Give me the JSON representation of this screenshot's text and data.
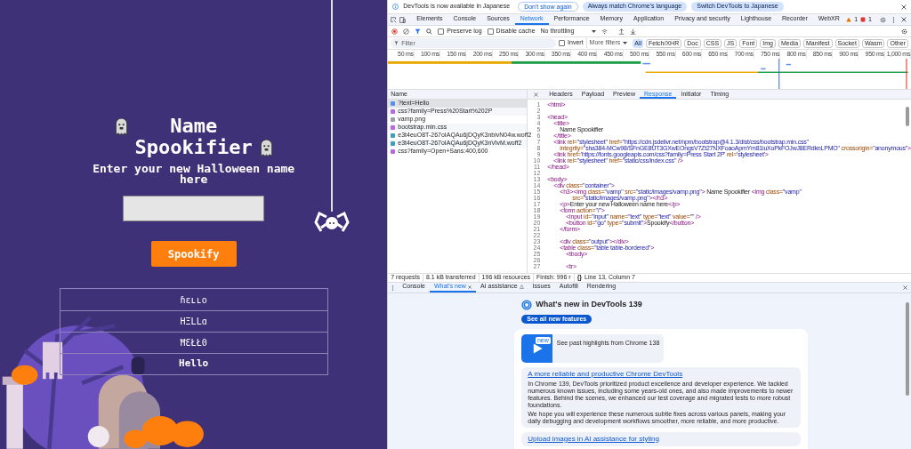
{
  "page": {
    "heading": "Name Spookifier",
    "prompt": "Enter your new Halloween name here",
    "button": "Spookify",
    "results": [
      "ɦɛʟʟօ",
      "HΞLLɑ",
      "ĦƐŁŁ0",
      "Hello"
    ]
  },
  "devtools": {
    "banner": {
      "message": "DevTools is now available in Japanese",
      "buttons": [
        {
          "label": "Don't show again",
          "kind": "outline"
        },
        {
          "label": "Always match Chrome's language",
          "kind": "filled"
        },
        {
          "label": "Switch DevTools to Japanese",
          "kind": "filled"
        }
      ]
    },
    "tabs": [
      {
        "label": "Elements",
        "selected": false
      },
      {
        "label": "Console",
        "selected": false
      },
      {
        "label": "Sources",
        "selected": false
      },
      {
        "label": "Network",
        "selected": true
      },
      {
        "label": "Performance",
        "selected": false
      },
      {
        "label": "Memory",
        "selected": false
      },
      {
        "label": "Application",
        "selected": false
      },
      {
        "label": "Privacy and security",
        "selected": false
      },
      {
        "label": "Lighthouse",
        "selected": false
      },
      {
        "label": "Recorder",
        "selected": false
      },
      {
        "label": "WebXR",
        "selected": false
      }
    ],
    "warnings": "1",
    "errors": "1",
    "toolbar": {
      "preserve_log": {
        "label": "Preserve log",
        "checked": false
      },
      "disable_cache": {
        "label": "Disable cache",
        "checked": false
      },
      "throttling": "No throttling"
    },
    "filter": {
      "placeholder": "Filter",
      "invert": {
        "label": "Invert",
        "checked": false
      },
      "more_filters": "More filters",
      "types": [
        {
          "label": "All",
          "selected": true
        },
        {
          "label": "Fetch/XHR",
          "selected": false
        },
        {
          "label": "Doc",
          "selected": false
        },
        {
          "label": "CSS",
          "selected": false
        },
        {
          "label": "JS",
          "selected": false
        },
        {
          "label": "Font",
          "selected": false
        },
        {
          "label": "Img",
          "selected": false
        },
        {
          "label": "Media",
          "selected": false
        },
        {
          "label": "Manifest",
          "selected": false
        },
        {
          "label": "Socket",
          "selected": false
        },
        {
          "label": "Wasm",
          "selected": false
        },
        {
          "label": "Other",
          "selected": false
        }
      ]
    },
    "timeline": {
      "ticks": [
        "50 ms",
        "100 ms",
        "150 ms",
        "200 ms",
        "250 ms",
        "300 ms",
        "350 ms",
        "400 ms",
        "450 ms",
        "500 ms",
        "550 ms",
        "600 ms",
        "650 ms",
        "700 ms",
        "750 ms",
        "800 ms",
        "850 ms",
        "900 ms",
        "950 ms",
        "1,000 ms"
      ]
    },
    "requests": {
      "column": "Name",
      "items": [
        {
          "name": "?text=Hello",
          "kind": "doc",
          "selected": true
        },
        {
          "name": "css?family=Press%20Start%202P",
          "kind": "css",
          "selected": false
        },
        {
          "name": "vamp.png",
          "kind": "img",
          "selected": false
        },
        {
          "name": "bootstrap.min.css",
          "kind": "css",
          "selected": false
        },
        {
          "name": "e3t4euO8T-267oIAQAu6jDQyK3nbivN04w.woff2",
          "kind": "font",
          "selected": false
        },
        {
          "name": "e3t4euO8T-267oIAQAu6jDQyK3nVivM.woff2",
          "kind": "font",
          "selected": false
        },
        {
          "name": "css?family=Open+Sans:400,600",
          "kind": "css",
          "selected": false
        }
      ]
    },
    "detail_tabs": [
      {
        "label": "Headers",
        "selected": false
      },
      {
        "label": "Payload",
        "selected": false
      },
      {
        "label": "Preview",
        "selected": false
      },
      {
        "label": "Response",
        "selected": true
      },
      {
        "label": "Initiator",
        "selected": false
      },
      {
        "label": "Timing",
        "selected": false
      }
    ],
    "response_lines": [
      {
        "number": "1",
        "parts": [
          {
            "kind": "tag",
            "text": "<html>"
          }
        ]
      },
      {
        "number": "2"
      },
      {
        "number": "3",
        "parts": [
          {
            "kind": "tag",
            "text": "<head>"
          }
        ]
      },
      {
        "number": "4",
        "parts": [
          {
            "kind": "tag",
            "text": "    <title>"
          }
        ]
      },
      {
        "number": "5",
        "parts": [
          {
            "kind": "text",
            "text": "        Name Spookifier"
          }
        ]
      },
      {
        "number": "6",
        "parts": [
          {
            "kind": "tag",
            "text": "    </title>"
          }
        ]
      },
      {
        "number": "7",
        "parts": [
          {
            "kind": "tag",
            "text": "    <link "
          },
          {
            "kind": "attr",
            "text": "rel="
          },
          {
            "kind": "val",
            "text": "\"stylesheet\" "
          },
          {
            "kind": "attr",
            "text": "href="
          },
          {
            "kind": "val",
            "text": "\"https://cdn.jsdelivr.net/npm/bootstrap@4.1.3/dist/css/bootstrap.min.css\""
          }
        ]
      },
      {
        "number": "8",
        "parts": [
          {
            "kind": "attr",
            "text": "        integrity="
          },
          {
            "kind": "val",
            "text": "\"sha384-MCw98/SFnGE8fJT3GXwEOngsV7Zt27NXFoaoApmYm81iuXoPkFOJwJ8ERdknLPMO\" "
          },
          {
            "kind": "attr",
            "text": "crossorigin="
          },
          {
            "kind": "val",
            "text": "\"anonymous\""
          },
          {
            "kind": "tag",
            "text": ">"
          }
        ]
      },
      {
        "number": "9",
        "parts": [
          {
            "kind": "tag",
            "text": "    <link "
          },
          {
            "kind": "attr",
            "text": "href="
          },
          {
            "kind": "val",
            "text": "'https://fonts.googleapis.com/css?family=Press Start 2P' "
          },
          {
            "kind": "attr",
            "text": "rel="
          },
          {
            "kind": "val",
            "text": "'stylesheet'"
          },
          {
            "kind": "tag",
            "text": ">"
          }
        ]
      },
      {
        "number": "10",
        "parts": [
          {
            "kind": "tag",
            "text": "    <link "
          },
          {
            "kind": "attr",
            "text": "rel="
          },
          {
            "kind": "val",
            "text": "\"stylesheet\" "
          },
          {
            "kind": "attr",
            "text": "href="
          },
          {
            "kind": "val",
            "text": "\"static/css/index.css\" "
          },
          {
            "kind": "tag",
            "text": "/>"
          }
        ]
      },
      {
        "number": "11",
        "parts": [
          {
            "kind": "tag",
            "text": "</head>"
          }
        ]
      },
      {
        "number": "12"
      },
      {
        "number": "13",
        "parts": [
          {
            "kind": "tag",
            "text": "<body>"
          }
        ]
      },
      {
        "number": "14",
        "parts": [
          {
            "kind": "tag",
            "text": "    <div "
          },
          {
            "kind": "attr",
            "text": "class="
          },
          {
            "kind": "val",
            "text": "\"container\""
          },
          {
            "kind": "tag",
            "text": ">"
          }
        ]
      },
      {
        "number": "15",
        "parts": [
          {
            "kind": "tag",
            "text": "        <h3><img "
          },
          {
            "kind": "attr",
            "text": "class="
          },
          {
            "kind": "val",
            "text": "\"vamp\" "
          },
          {
            "kind": "attr",
            "text": "src="
          },
          {
            "kind": "val",
            "text": "\"static/images/vamp.png\""
          },
          {
            "kind": "tag",
            "text": ">"
          },
          {
            "kind": "text",
            "text": " Name Spookifier "
          },
          {
            "kind": "tag",
            "text": "<img "
          },
          {
            "kind": "attr",
            "text": "class="
          },
          {
            "kind": "val",
            "text": "\"vamp\""
          }
        ]
      },
      {
        "number": "16",
        "parts": [
          {
            "kind": "attr",
            "text": "                src="
          },
          {
            "kind": "val",
            "text": "\"static/images/vamp.png\""
          },
          {
            "kind": "tag",
            "text": "></h3>"
          }
        ]
      },
      {
        "number": "17",
        "parts": [
          {
            "kind": "tag",
            "text": "        <p>"
          },
          {
            "kind": "text",
            "text": "Enter your new Halloween name here"
          },
          {
            "kind": "tag",
            "text": "</p>"
          }
        ]
      },
      {
        "number": "18",
        "parts": [
          {
            "kind": "tag",
            "text": "        <form "
          },
          {
            "kind": "attr",
            "text": "action="
          },
          {
            "kind": "val",
            "text": "\"/\""
          },
          {
            "kind": "tag",
            "text": ">"
          }
        ]
      },
      {
        "number": "19",
        "parts": [
          {
            "kind": "tag",
            "text": "            <input "
          },
          {
            "kind": "attr",
            "text": "id="
          },
          {
            "kind": "val",
            "text": "\"input\" "
          },
          {
            "kind": "attr",
            "text": "name="
          },
          {
            "kind": "val",
            "text": "\"text\" "
          },
          {
            "kind": "attr",
            "text": "type="
          },
          {
            "kind": "val",
            "text": "\"text\" "
          },
          {
            "kind": "attr",
            "text": "value="
          },
          {
            "kind": "val",
            "text": "\"\" "
          },
          {
            "kind": "tag",
            "text": "/>"
          }
        ]
      },
      {
        "number": "20",
        "parts": [
          {
            "kind": "tag",
            "text": "            <button "
          },
          {
            "kind": "attr",
            "text": "id="
          },
          {
            "kind": "val",
            "text": "\"go\" "
          },
          {
            "kind": "attr",
            "text": "type="
          },
          {
            "kind": "val",
            "text": "\"submit\""
          },
          {
            "kind": "tag",
            "text": ">"
          },
          {
            "kind": "text",
            "text": "Spookify"
          },
          {
            "kind": "tag",
            "text": "</button>"
          }
        ]
      },
      {
        "number": "21",
        "parts": [
          {
            "kind": "tag",
            "text": "        </form>"
          }
        ]
      },
      {
        "number": "22"
      },
      {
        "number": "23",
        "parts": [
          {
            "kind": "tag",
            "text": "        <div "
          },
          {
            "kind": "attr",
            "text": "class="
          },
          {
            "kind": "val",
            "text": "\"output\""
          },
          {
            "kind": "tag",
            "text": "></div>"
          }
        ]
      },
      {
        "number": "24",
        "parts": [
          {
            "kind": "tag",
            "text": "        <table "
          },
          {
            "kind": "attr",
            "text": "class="
          },
          {
            "kind": "val",
            "text": "\"table table-bordered\""
          },
          {
            "kind": "tag",
            "text": ">"
          }
        ]
      },
      {
        "number": "25",
        "parts": [
          {
            "kind": "tag",
            "text": "            <tbody>"
          }
        ]
      },
      {
        "number": "26"
      },
      {
        "number": "27",
        "parts": [
          {
            "kind": "tag",
            "text": "            <tr>"
          }
        ]
      }
    ],
    "status": {
      "summary": [
        "7 requests",
        "8.1 kB transferred",
        "196 kB resources",
        "Finish: 996 r"
      ],
      "pretty_print": "{}",
      "cursor": "Line 13, Column 7"
    },
    "drawer": {
      "tabs": [
        {
          "label": "Console",
          "selected": false,
          "kind": "plain"
        },
        {
          "label": "What's new",
          "selected": true,
          "kind": "closable"
        },
        {
          "label": "AI assistance",
          "selected": false,
          "kind": "experimental"
        },
        {
          "label": "Issues",
          "selected": false,
          "kind": "plain"
        },
        {
          "label": "Autofill",
          "selected": false,
          "kind": "plain"
        },
        {
          "label": "Rendering",
          "selected": false,
          "kind": "plain"
        }
      ],
      "title": "What's new in DevTools 139",
      "button": "See all new features",
      "video": {
        "badge": "new",
        "caption": "See past highlights from Chrome 138"
      },
      "articles": [
        {
          "title": "A more reliable and productive Chrome DevTools",
          "paragraphs": [
            "In Chrome 139, DevTools prioritized product excellence and developer experience. We tackled numerous known issues, including some years-old ones, and also made improvements to newer features. Behind the scenes, we enhanced our test coverage and migrated tests to more robust foundations.",
            "We hope you will experience these numerous subtle fixes across various panels, making your daily debugging and development workflows smoother, more reliable, and more productive."
          ]
        },
        {
          "title": "Upload images in AI assistance for styling"
        }
      ]
    }
  }
}
